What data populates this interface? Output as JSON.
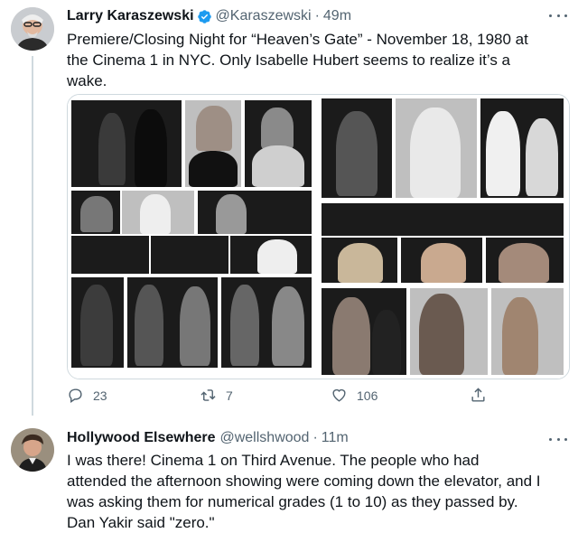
{
  "tweet1": {
    "author_name": "Larry Karaszewski",
    "handle": "@Karaszewski",
    "separator": "·",
    "time": "49m",
    "text_lines": [
      "Premiere/Closing Night for “Heaven’s Gate” - November 18, 1980 at",
      "the Cinema 1 in NYC.  Only Isabelle Hubert seems to realize it’s a",
      "wake."
    ],
    "replies": "23",
    "retweets": "7",
    "likes": "106",
    "icons": {
      "verified": "verified-badge-icon",
      "reply": "reply-icon",
      "retweet": "retweet-icon",
      "like": "heart-icon",
      "share": "share-icon",
      "more": "more-options-icon"
    },
    "accent_color": "#1d9bf0"
  },
  "tweet2": {
    "author_name": "Hollywood Elsewhere",
    "handle": "@wellshwood",
    "separator": "·",
    "time": "11m",
    "text_lines": [
      "I was there!  Cinema 1 on Third Avenue.  The people who had",
      "attended the afternoon showing were coming down the elevator, and I",
      "was asking them for numerical grades (1 to 10) as they passed by.",
      "Dan Yakir said \"zero.\""
    ]
  }
}
